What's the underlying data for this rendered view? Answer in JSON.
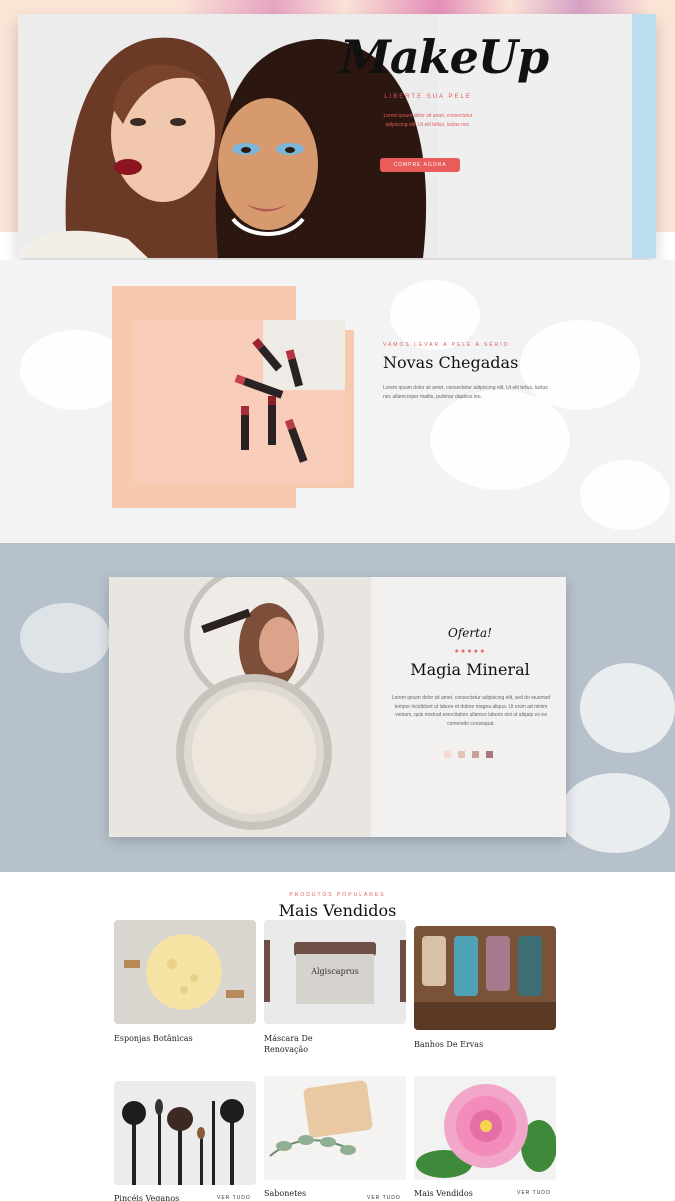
{
  "hero": {
    "logo": "MakeUp",
    "tagline": "LIBERTE SUA PELE",
    "text": "Lorem ipsum dolor sit amet, consectetur adipiscing elit. Ut elit tellus, luctus nec.",
    "button": "COMPRE AGORA"
  },
  "novas": {
    "eyebrow": "VAMOS LEVAR A PELE A SÉRIO",
    "title": "Novas Chegadas",
    "text": "Lorem ipsum dolor sit amet, consectetur adipiscing elit. Ut elit tellus, luctus nec ullamcorper mattis, pulvinar dapibus leo."
  },
  "magia": {
    "eyebrow": "Oferta!",
    "stars": "★★★★★",
    "title": "Magia Mineral",
    "text": "Lorem ipsum dolor sit amet, consectetur adipiscing elit, sed do eiusmod tempor incididunt ut labore et dolore magna aliqua. Ut enim ad minim veniam, quis nostrud exercitation ullamco laboris nisi ut aliquip ex ea commodo consequat.",
    "swatch_colors": [
      "#f7d9cf",
      "#e6c1b7",
      "#c9a39b",
      "#a9787a"
    ]
  },
  "mais_vendidos": {
    "eyebrow": "PRODUTOS POPULARES",
    "title": "Mais Vendidos",
    "products": [
      {
        "name": "Esponjas Botânicas"
      },
      {
        "name": "Máscara De Renovação"
      },
      {
        "name": "Banhos De Ervas"
      },
      {
        "name": "Pincéis Veganos",
        "link": "VER TUDO"
      },
      {
        "name": "Sabonetes",
        "link": "VER TUDO"
      },
      {
        "name": "Mais Vendidos",
        "link": "VER TUDO"
      }
    ]
  },
  "jar_label": "Algiscaprus"
}
